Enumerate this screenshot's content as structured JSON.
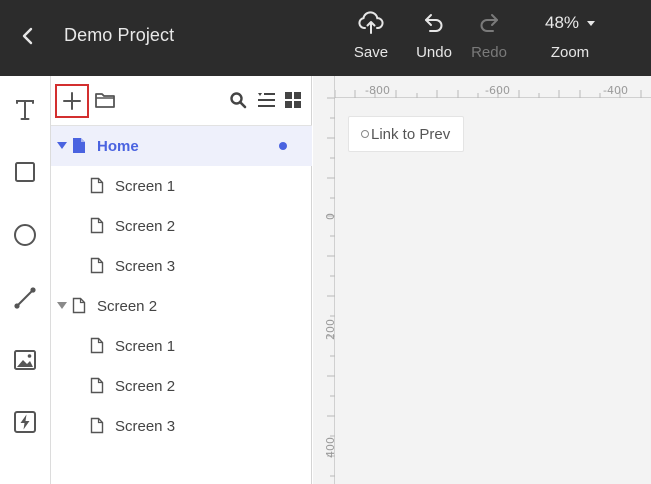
{
  "topbar": {
    "project_title": "Demo Project",
    "save_label": "Save",
    "undo_label": "Undo",
    "redo_label": "Redo",
    "zoom_value": "48%",
    "zoom_label": "Zoom"
  },
  "tools": [
    "text-tool",
    "rectangle-tool",
    "ellipse-tool",
    "line-tool",
    "image-tool",
    "interaction-tool"
  ],
  "pages": [
    {
      "label": "Home",
      "level": 0,
      "expanded": true,
      "selected": true
    },
    {
      "label": "Screen 1",
      "level": 1
    },
    {
      "label": "Screen 2",
      "level": 1
    },
    {
      "label": "Screen 3",
      "level": 1
    },
    {
      "label": "Screen 2",
      "level": 0,
      "expanded": true
    },
    {
      "label": "Screen 1",
      "level": 1
    },
    {
      "label": "Screen 2",
      "level": 1
    },
    {
      "label": "Screen 3",
      "level": 1
    }
  ],
  "canvas": {
    "ruler_top_labels": [
      "-800",
      "-600",
      "-400"
    ],
    "ruler_left_labels": [
      "0",
      "200",
      "400"
    ],
    "link_card_label": "Link to Prev"
  },
  "colors": {
    "topbar_bg": "#2c2c2c",
    "accent": "#4a63e0",
    "add_button_highlight": "#d32f2f",
    "canvas_bg": "#f3f3f3"
  }
}
